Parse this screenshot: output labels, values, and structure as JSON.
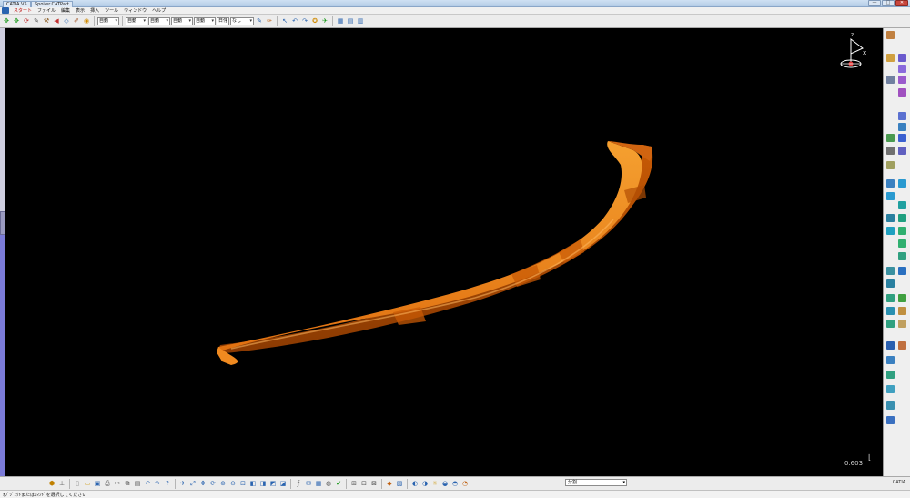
{
  "window": {
    "title": "CATIA V5",
    "document_tab": "Spoiler.CATPart",
    "controls": [
      "—",
      "□",
      "✕"
    ]
  },
  "menu": {
    "items": [
      "スタート",
      "ファイル",
      "編集",
      "表示",
      "挿入",
      "ツール",
      "ウィンドウ",
      "ヘルプ"
    ]
  },
  "toolbar": {
    "dropdowns": [
      "自動",
      "自動",
      "自動",
      "自動",
      "自動",
      "日付",
      "なし"
    ]
  },
  "viewport": {
    "background": "#000000",
    "part_color": "#e07010",
    "compass_x": "x",
    "compass_z": "z",
    "scale_value": "0.603"
  },
  "status": {
    "text": "ｵﾌﾞｼﾞｪｸﾄまたはｺﾏﾝﾄﾞを選択してください",
    "command_input": "分割"
  },
  "logo": "CATIA"
}
